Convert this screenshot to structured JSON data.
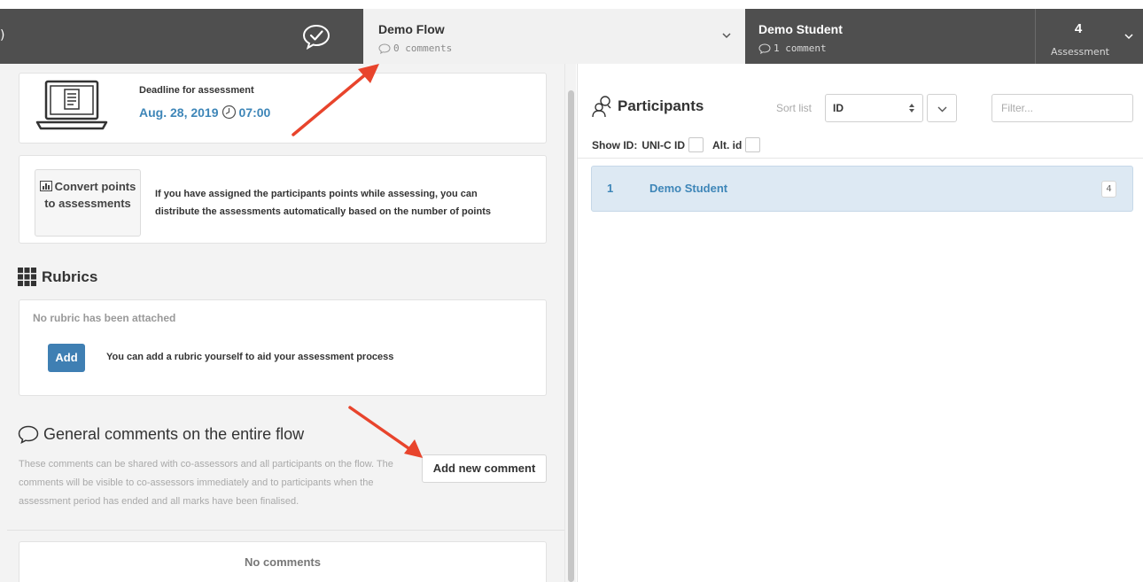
{
  "topbar": {
    "left_fragment": ")",
    "flow": {
      "title": "Demo Flow",
      "comments": "0 comments"
    },
    "student": {
      "title": "Demo Student",
      "comments": "1 comment"
    },
    "assessment": {
      "value": "4",
      "label": "Assessment"
    }
  },
  "deadline": {
    "label": "Deadline for assessment",
    "date": "Aug. 28, 2019",
    "time": "07:00"
  },
  "convert": {
    "button_label": "Convert points to assessments",
    "text": "If you have assigned the participants points while assessing, you can distribute the assessments automatically based on the number of points"
  },
  "rubrics": {
    "title": "Rubrics",
    "empty_text": "No rubric has been attached",
    "add_label": "Add",
    "add_hint": "You can add a rubric yourself to aid your assessment process"
  },
  "general_comments": {
    "title": "General comments on the entire flow",
    "description": "These comments can be shared with co-assessors and all participants on the flow. The comments will be visible to co-assessors immediately and to participants when the assessment period has ended and all marks have been finalised.",
    "add_label": "Add new comment",
    "empty_text": "No comments"
  },
  "participants": {
    "title": "Participants",
    "sort_label": "Sort list",
    "sort_value": "ID",
    "filter_placeholder": "Filter...",
    "show_id_label": "Show ID:",
    "show_id_options": [
      "UNI-C ID",
      "Alt. id"
    ],
    "rows": [
      {
        "id": "1",
        "name": "Demo Student",
        "badge": "4"
      }
    ]
  },
  "colors": {
    "topbar_dark": "#4f4f4f",
    "accent_blue": "#3e86b8",
    "add_button": "#3f7fb3",
    "row_highlight": "#dde9f3",
    "annotation_arrow": "#e8442c"
  }
}
